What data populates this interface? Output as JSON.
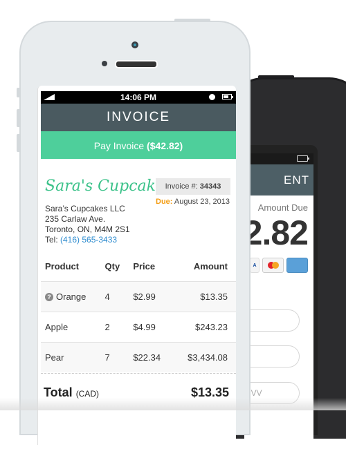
{
  "back_phone": {
    "header_partial": "ENT",
    "amount_label": "Amount Due",
    "amount_partial": "2.82",
    "cards": [
      "visa-card-icon",
      "mastercard-icon",
      "amex-icon"
    ],
    "visa_text": "A",
    "cvv_placeholder": "CVV"
  },
  "status_bar": {
    "time": "14:06 PM"
  },
  "header": {
    "title": "INVOICE"
  },
  "pay_button": {
    "label": "Pay Invoice ",
    "amount": "($42.82)"
  },
  "company": {
    "logo": "Sara's Cupcakes",
    "name": "Sara’s Cupcakes LLC",
    "street": "235 Carlaw Ave.",
    "city": "Toronto, ON, M4M 2S1",
    "tel_label": "Tel: ",
    "tel": "(416) 565-3433"
  },
  "invoice": {
    "number_label": "Invoice #: ",
    "number": "34343",
    "due_label": "Due:",
    "due_date": " August 23, 2013"
  },
  "table": {
    "headers": [
      "Product",
      "Qty",
      "Price",
      "Amount"
    ],
    "rows": [
      {
        "product": "Orange",
        "qty": "4",
        "price": "$2.99",
        "amount": "$13.35",
        "has_help": true
      },
      {
        "product": "Apple",
        "qty": "2",
        "price": "$4.99",
        "amount": "$243.23"
      },
      {
        "product": "Pear",
        "qty": "7",
        "price": "$22.34",
        "amount": "$3,434.08"
      }
    ]
  },
  "total": {
    "label": "Total",
    "currency": "(CAD)",
    "value": "$13.35"
  },
  "colors": {
    "accent": "#4ecf9b",
    "header": "#4a5a60",
    "due": "#f39c12",
    "link": "#2e8ccf"
  }
}
